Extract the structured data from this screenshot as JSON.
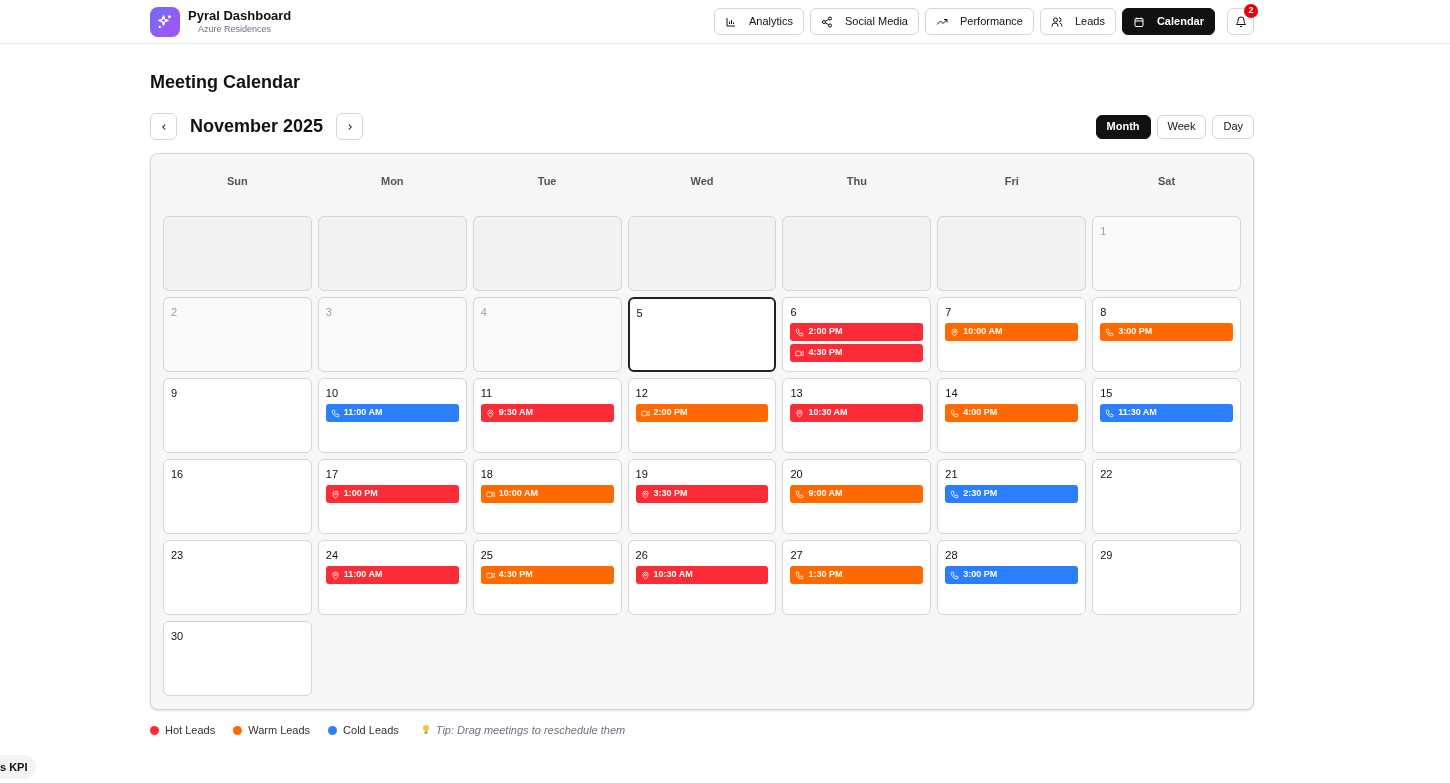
{
  "app": {
    "title": "Pyral Dashboard",
    "subtitle": "Azure Residences"
  },
  "nav": [
    {
      "label": "Analytics",
      "selected": false
    },
    {
      "label": "Social Media",
      "selected": false
    },
    {
      "label": "Performance",
      "selected": false
    },
    {
      "label": "Leads",
      "selected": false
    },
    {
      "label": "Calendar",
      "selected": true
    }
  ],
  "notifications": {
    "count": "2"
  },
  "page_title": "Meeting Calendar",
  "month_label": "November 2025",
  "views": [
    {
      "label": "Month",
      "selected": true
    },
    {
      "label": "Week",
      "selected": false
    },
    {
      "label": "Day",
      "selected": false
    }
  ],
  "weekdays": [
    "Sun",
    "Mon",
    "Tue",
    "Wed",
    "Thu",
    "Fri",
    "Sat"
  ],
  "days": [
    {
      "kind": "blank"
    },
    {
      "kind": "blank"
    },
    {
      "kind": "blank"
    },
    {
      "kind": "blank"
    },
    {
      "kind": "blank"
    },
    {
      "kind": "blank"
    },
    {
      "kind": "day",
      "day": "1",
      "past": true,
      "today": false
    },
    {
      "kind": "day",
      "day": "2",
      "past": true,
      "today": false
    },
    {
      "kind": "day",
      "day": "3",
      "past": true,
      "today": false
    },
    {
      "kind": "day",
      "day": "4",
      "past": true,
      "today": false
    },
    {
      "kind": "day",
      "day": "5",
      "past": false,
      "today": true
    },
    {
      "kind": "day",
      "day": "6",
      "past": false,
      "today": false,
      "events": [
        {
          "time": "2:00 PM",
          "kind": "phone",
          "color": "#fb2c36"
        },
        {
          "time": "4:30 PM",
          "kind": "video",
          "color": "#fb2c36"
        }
      ]
    },
    {
      "kind": "day",
      "day": "7",
      "past": false,
      "today": false,
      "events": [
        {
          "time": "10:00 AM",
          "kind": "location",
          "color": "#ff6900"
        }
      ]
    },
    {
      "kind": "day",
      "day": "8",
      "past": false,
      "today": false,
      "events": [
        {
          "time": "3:00 PM",
          "kind": "phone",
          "color": "#ff6900"
        }
      ]
    },
    {
      "kind": "day",
      "day": "9",
      "past": false,
      "today": false
    },
    {
      "kind": "day",
      "day": "10",
      "past": false,
      "today": false,
      "events": [
        {
          "time": "11:00 AM",
          "kind": "phone",
          "color": "#2b7fff"
        }
      ]
    },
    {
      "kind": "day",
      "day": "11",
      "past": false,
      "today": false,
      "events": [
        {
          "time": "9:30 AM",
          "kind": "location",
          "color": "#fb2c36"
        }
      ]
    },
    {
      "kind": "day",
      "day": "12",
      "past": false,
      "today": false,
      "events": [
        {
          "time": "2:00 PM",
          "kind": "video",
          "color": "#ff6900"
        }
      ]
    },
    {
      "kind": "day",
      "day": "13",
      "past": false,
      "today": false,
      "events": [
        {
          "time": "10:30 AM",
          "kind": "location",
          "color": "#fb2c36"
        }
      ]
    },
    {
      "kind": "day",
      "day": "14",
      "past": false,
      "today": false,
      "events": [
        {
          "time": "4:00 PM",
          "kind": "phone",
          "color": "#ff6900"
        }
      ]
    },
    {
      "kind": "day",
      "day": "15",
      "past": false,
      "today": false,
      "events": [
        {
          "time": "11:30 AM",
          "kind": "phone",
          "color": "#2b7fff"
        }
      ]
    },
    {
      "kind": "day",
      "day": "16",
      "past": false,
      "today": false
    },
    {
      "kind": "day",
      "day": "17",
      "past": false,
      "today": false,
      "events": [
        {
          "time": "1:00 PM",
          "kind": "location",
          "color": "#fb2c36"
        }
      ]
    },
    {
      "kind": "day",
      "day": "18",
      "past": false,
      "today": false,
      "events": [
        {
          "time": "10:00 AM",
          "kind": "video",
          "color": "#ff6900"
        }
      ]
    },
    {
      "kind": "day",
      "day": "19",
      "past": false,
      "today": false,
      "events": [
        {
          "time": "3:30 PM",
          "kind": "location",
          "color": "#fb2c36"
        }
      ]
    },
    {
      "kind": "day",
      "day": "20",
      "past": false,
      "today": false,
      "events": [
        {
          "time": "9:00 AM",
          "kind": "phone",
          "color": "#ff6900"
        }
      ]
    },
    {
      "kind": "day",
      "day": "21",
      "past": false,
      "today": false,
      "events": [
        {
          "time": "2:30 PM",
          "kind": "phone",
          "color": "#2b7fff"
        }
      ]
    },
    {
      "kind": "day",
      "day": "22",
      "past": false,
      "today": false
    },
    {
      "kind": "day",
      "day": "23",
      "past": false,
      "today": false
    },
    {
      "kind": "day",
      "day": "24",
      "past": false,
      "today": false,
      "events": [
        {
          "time": "11:00 AM",
          "kind": "location",
          "color": "#fb2c36"
        }
      ]
    },
    {
      "kind": "day",
      "day": "25",
      "past": false,
      "today": false,
      "events": [
        {
          "time": "4:30 PM",
          "kind": "video",
          "color": "#ff6900"
        }
      ]
    },
    {
      "kind": "day",
      "day": "26",
      "past": false,
      "today": false,
      "events": [
        {
          "time": "10:30 AM",
          "kind": "location",
          "color": "#fb2c36"
        }
      ]
    },
    {
      "kind": "day",
      "day": "27",
      "past": false,
      "today": false,
      "events": [
        {
          "time": "1:30 PM",
          "kind": "phone",
          "color": "#ff6900"
        }
      ]
    },
    {
      "kind": "day",
      "day": "28",
      "past": false,
      "today": false,
      "events": [
        {
          "time": "3:00 PM",
          "kind": "phone",
          "color": "#2b7fff"
        }
      ]
    },
    {
      "kind": "day",
      "day": "29",
      "past": false,
      "today": false
    },
    {
      "kind": "day",
      "day": "30",
      "past": false,
      "today": false
    }
  ],
  "legend": [
    {
      "label": "Hot Leads",
      "color": "#fb2c36"
    },
    {
      "label": "Warm Leads",
      "color": "#ff6900"
    },
    {
      "label": "Cold Leads",
      "color": "#2b7fff"
    }
  ],
  "tip": "Tip: Drag meetings to reschedule them",
  "corner_pill": "s KPI"
}
